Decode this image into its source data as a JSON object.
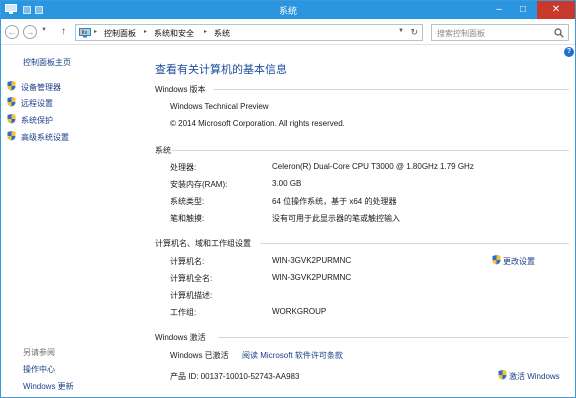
{
  "window": {
    "title": "系统"
  },
  "nav": {
    "back_glyph": "←",
    "forward_glyph": "→",
    "up_glyph": "↑",
    "breadcrumbs": [
      "控制面板",
      "系统和安全",
      "系统"
    ],
    "crumb_sep": "▸",
    "search_placeholder": "搜索控制面板"
  },
  "sidebar": {
    "home": "控制面板主页",
    "links": [
      "设备管理器",
      "远程设置",
      "系统保护",
      "高级系统设置"
    ],
    "see_also_title": "另请参阅",
    "see_also": [
      "操作中心",
      "Windows 更新"
    ]
  },
  "main": {
    "page_title": "查看有关计算机的基本信息",
    "edition": {
      "section": "Windows 版本",
      "name": "Windows Technical Preview",
      "copyright": "© 2014 Microsoft Corporation. All rights reserved."
    },
    "system": {
      "section": "系统",
      "rows": [
        {
          "label": "处理器:",
          "value": "Celeron(R) Dual-Core CPU      T3000  @ 1.80GHz   1.79 GHz"
        },
        {
          "label": "安装内存(RAM):",
          "value": "3.00 GB"
        },
        {
          "label": "系统类型:",
          "value": "64 位操作系统，基于 x64 的处理器"
        },
        {
          "label": "笔和触摸:",
          "value": "没有可用于此显示器的笔或触控输入"
        }
      ]
    },
    "computer": {
      "section": "计算机名、域和工作组设置",
      "rows": [
        {
          "label": "计算机名:",
          "value": "WIN-3GVK2PURMNC"
        },
        {
          "label": "计算机全名:",
          "value": "WIN-3GVK2PURMNC"
        },
        {
          "label": "计算机描述:",
          "value": ""
        },
        {
          "label": "工作组:",
          "value": "WORKGROUP"
        }
      ],
      "change_settings": "更改设置"
    },
    "activation": {
      "section": "Windows 激活",
      "status": "Windows 已激活",
      "license_link": "阅读 Microsoft 软件许可条款",
      "product_id": "产品 ID: 00137-10010-52743-AA983",
      "activate_link": "激活 Windows"
    }
  },
  "colors": {
    "titlebar": "#2c95df",
    "close": "#c7392a",
    "title_blue": "#1c4c9c",
    "link": "#1a3e8a"
  }
}
